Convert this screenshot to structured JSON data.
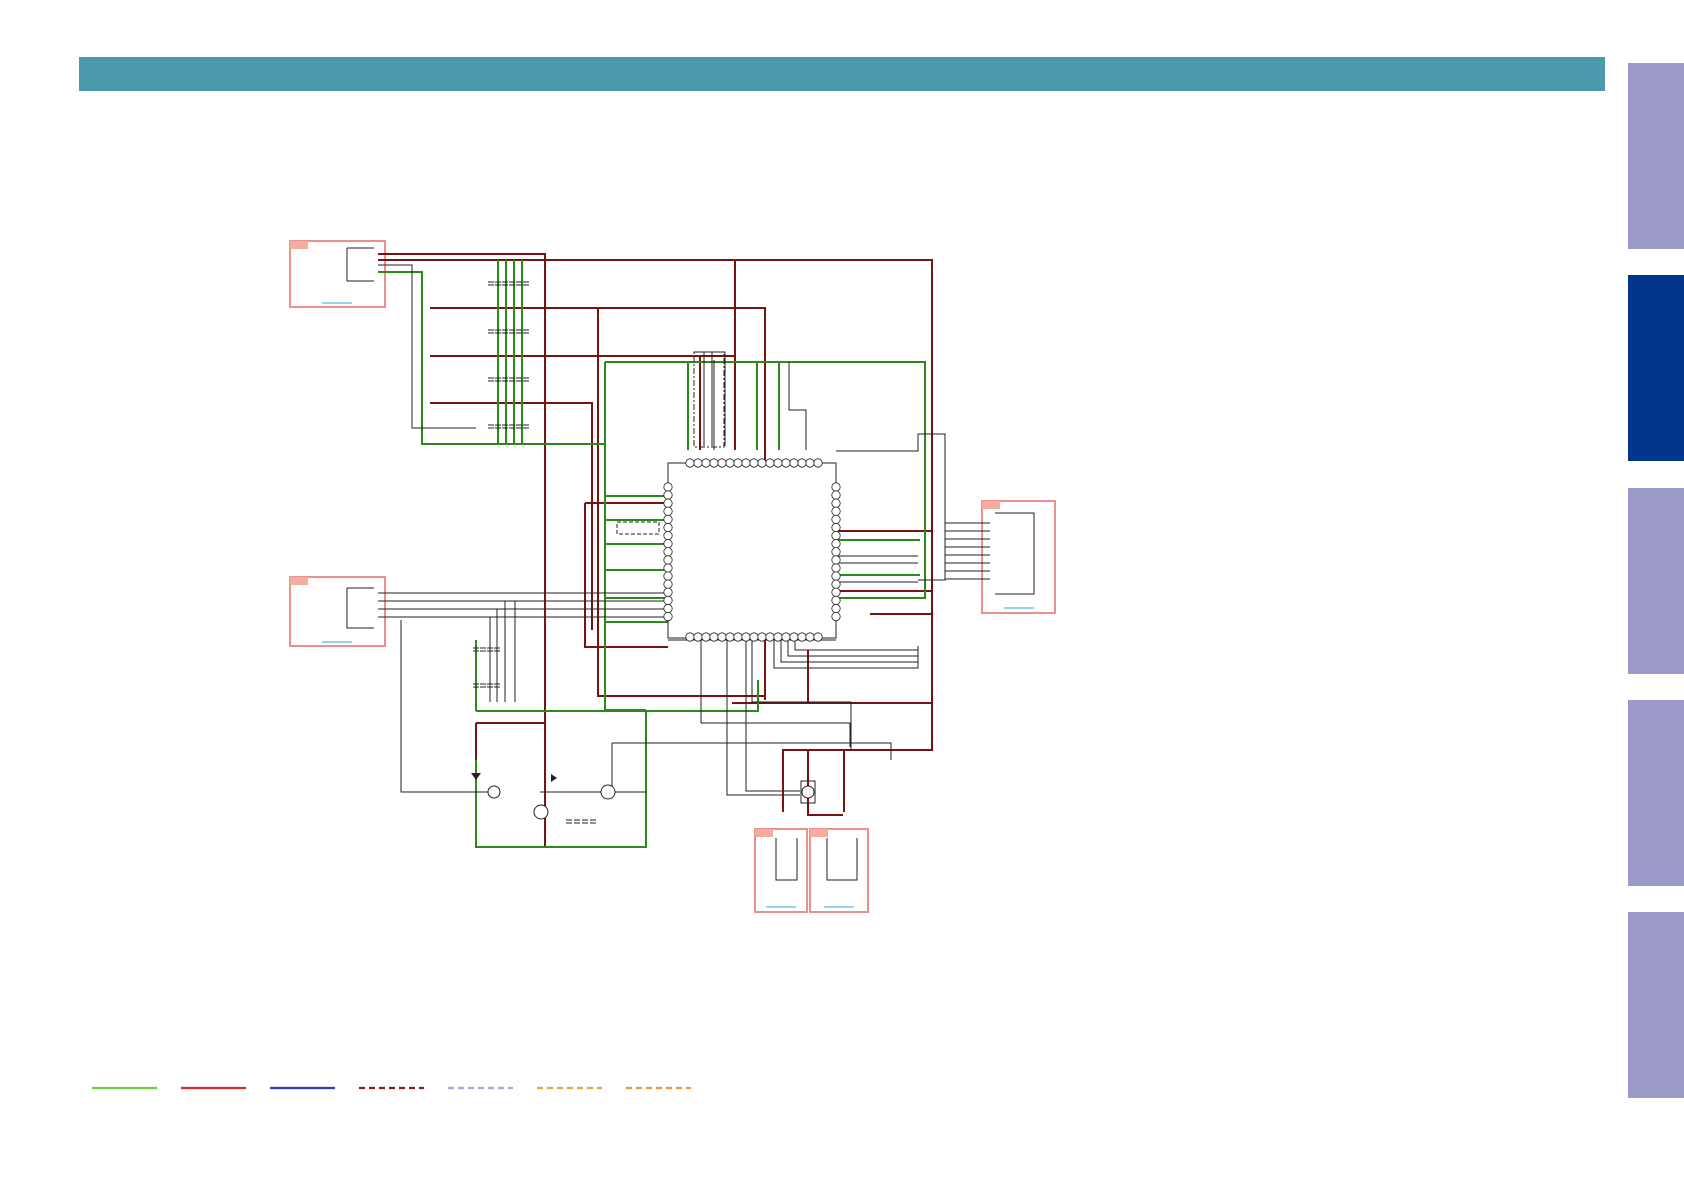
{
  "colors": {
    "header": "#4a9aac",
    "tab_inactive": "#9b9ac8",
    "tab_active": "#01368c",
    "box_border": "#ee8f8f",
    "box_tag": "#f3ad9e",
    "wire_green": "#2c8a1a",
    "wire_red": "#7a1212",
    "wire_black": "#222222",
    "link_blue": "#2aa9d8"
  },
  "side_tabs": [
    {
      "state": "inactive"
    },
    {
      "state": "active"
    },
    {
      "state": "inactive"
    },
    {
      "state": "inactive"
    },
    {
      "state": "inactive"
    }
  ],
  "legend": [
    {
      "style": "solid",
      "color": "#6bd13a"
    },
    {
      "style": "solid",
      "color": "#d42c2c"
    },
    {
      "style": "solid",
      "color": "#2a3eb8"
    },
    {
      "style": "dashed",
      "color": "#8b1a1a"
    },
    {
      "style": "dashed",
      "color": "#a6a6e6"
    },
    {
      "style": "dashed",
      "color": "#e6a43a"
    },
    {
      "style": "dashed",
      "color": "#e69a3a"
    }
  ]
}
